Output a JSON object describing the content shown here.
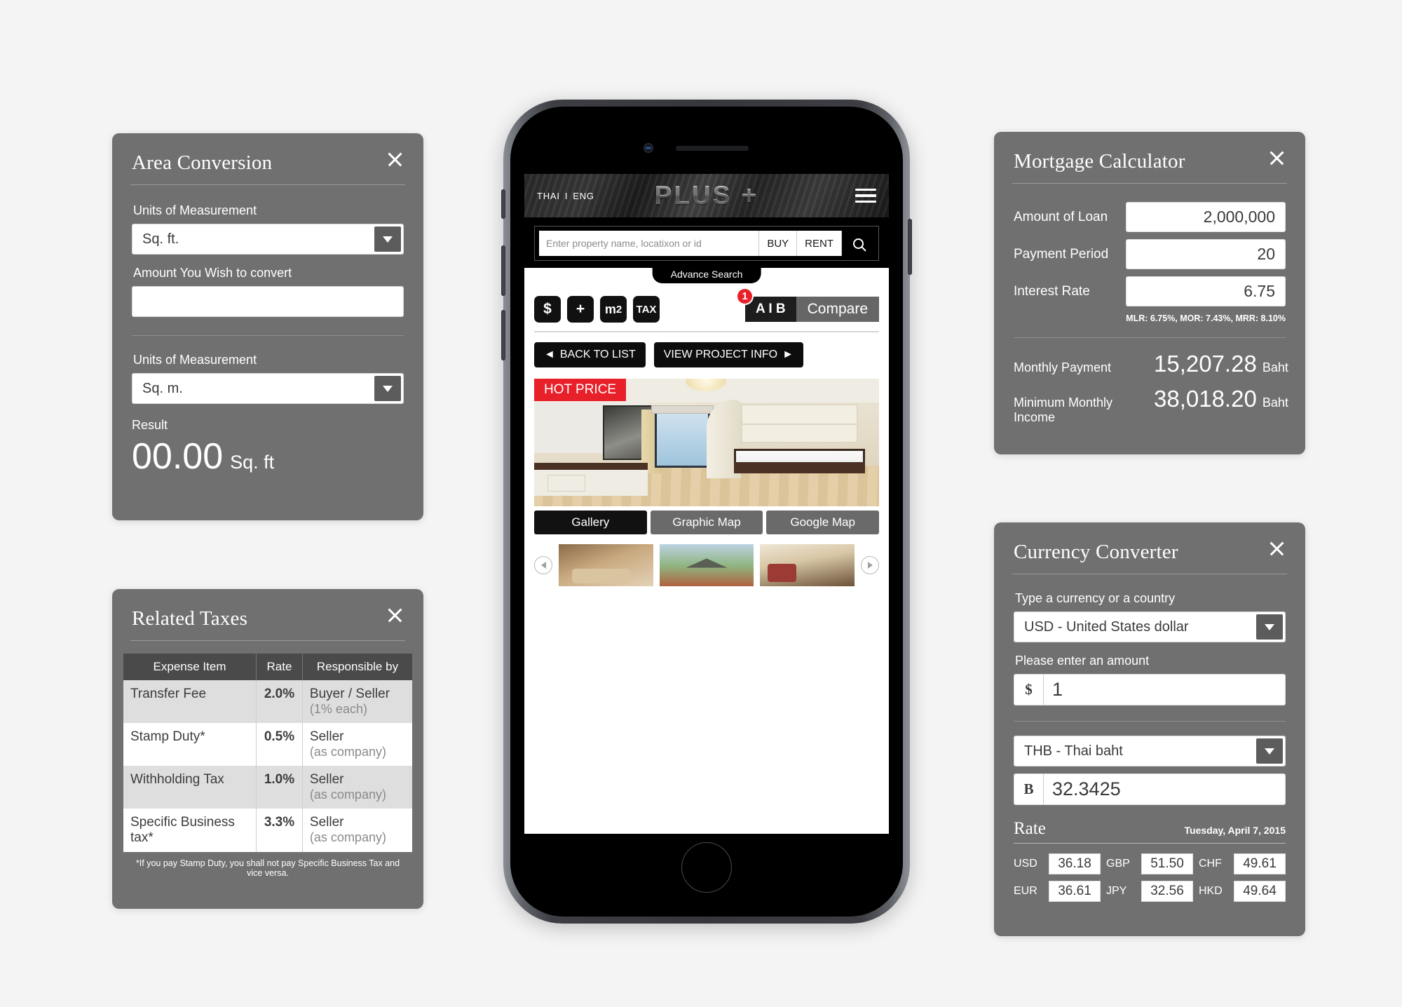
{
  "area_conversion": {
    "title": "Area Conversion",
    "close_label": "close-icon",
    "from_label": "Units of Measurement",
    "from_value": "Sq. ft.",
    "amount_label": "Amount You Wish to convert",
    "amount_value": "",
    "to_label": "Units of Measurement",
    "to_value": "Sq. m.",
    "result_label": "Result",
    "result_value": "00.00",
    "result_unit": "Sq. ft"
  },
  "related_taxes": {
    "title": "Related Taxes",
    "columns": [
      "Expense Item",
      "Rate",
      "Responsible by"
    ],
    "rows": [
      {
        "item": "Transfer Fee",
        "rate": "2.0%",
        "responsible": "Buyer / Seller",
        "sub": "(1% each)"
      },
      {
        "item": "Stamp Duty*",
        "rate": "0.5%",
        "responsible": "Seller",
        "sub": "(as company)"
      },
      {
        "item": "Withholding Tax",
        "rate": "1.0%",
        "responsible": "Seller",
        "sub": "(as company)"
      },
      {
        "item": "Specific Business tax*",
        "rate": "3.3%",
        "responsible": "Seller",
        "sub": "(as company)"
      }
    ],
    "footnote": "*If you pay Stamp Duty, you shall not pay Specific Business Tax and vice versa."
  },
  "mortgage": {
    "title": "Mortgage Calculator",
    "fields": [
      {
        "label": "Amount of Loan",
        "value": "2,000,000"
      },
      {
        "label": "Payment Period",
        "value": "20"
      },
      {
        "label": "Interest Rate",
        "value": "6.75"
      }
    ],
    "rate_note": "MLR: 6.75%, MOR: 7.43%, MRR: 8.10%",
    "outputs": [
      {
        "label": "Monthly Payment",
        "value": "15,207.28",
        "currency": "Baht"
      },
      {
        "label": "Minimum Monthly Income",
        "value": "38,018.20",
        "currency": "Baht"
      }
    ]
  },
  "currency": {
    "title": "Currency Converter",
    "from_label": "Type a currency or a country",
    "from_value": "USD - United States dollar",
    "amount_label": "Please enter an amount",
    "amount_symbol": "$",
    "amount_value": "1",
    "to_value": "THB - Thai baht",
    "result_symbol": "B",
    "result_value": "32.3425",
    "rate_title": "Rate",
    "rate_date": "Tuesday, April 7, 2015",
    "rates": [
      {
        "code": "USD",
        "value": "36.18"
      },
      {
        "code": "GBP",
        "value": "51.50"
      },
      {
        "code": "CHF",
        "value": "49.61"
      },
      {
        "code": "EUR",
        "value": "36.61"
      },
      {
        "code": "JPY",
        "value": "32.56"
      },
      {
        "code": "HKD",
        "value": "49.64"
      }
    ]
  },
  "phone": {
    "header": {
      "lang_thai": "THAI",
      "lang_sep": "I",
      "lang_eng": "ENG",
      "brand": "PLUS +",
      "menu_icon": "hamburger-icon"
    },
    "search": {
      "placeholder": "Enter property name, locatixon or id",
      "buy_label": "BUY",
      "rent_label": "RENT",
      "search_icon": "magnifier-icon"
    },
    "advance_search_label": "Advance Search",
    "tools": [
      {
        "icon": "dollar-icon",
        "label": "$"
      },
      {
        "icon": "plus-icon",
        "label": "+"
      },
      {
        "icon": "square-meter-icon",
        "label": "m2"
      },
      {
        "icon": "tax-icon",
        "label": "TAX"
      }
    ],
    "compare": {
      "badge": "1",
      "ab_label": "A I B",
      "compare_label": "Compare"
    },
    "nav": {
      "back_label": "BACK TO LIST",
      "back_arrow": "◄",
      "view_label": "VIEW PROJECT INFO",
      "view_arrow": "►"
    },
    "listing": {
      "badge": "HOT PRICE"
    },
    "map_tabs": [
      {
        "label": "Gallery",
        "active": true
      },
      {
        "label": "Graphic Map",
        "active": false
      },
      {
        "label": "Google Map",
        "active": false
      }
    ],
    "carousel": {
      "prev_icon": "chevron-left-icon",
      "next_icon": "chevron-right-icon",
      "thumb_count": 3
    }
  },
  "colors": {
    "panel_gray": "#707070",
    "page_bg": "#f4f4f5",
    "accent_red": "#e8202a",
    "black": "#000000"
  }
}
